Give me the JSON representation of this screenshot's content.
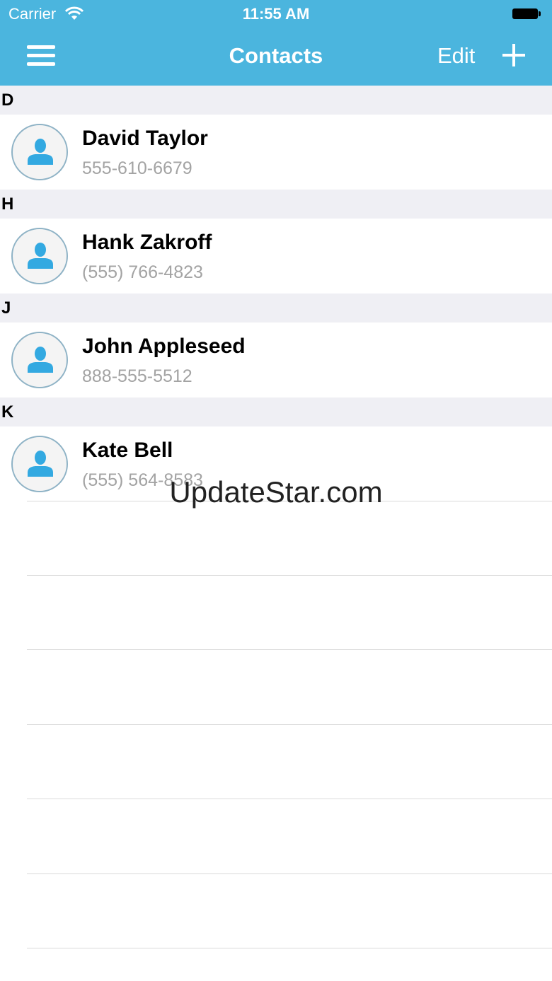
{
  "status_bar": {
    "carrier": "Carrier",
    "time": "11:55 AM"
  },
  "nav_bar": {
    "title": "Contacts",
    "edit_label": "Edit"
  },
  "sections": [
    {
      "letter": "D",
      "contacts": [
        {
          "name": "David Taylor",
          "phone": "555-610-6679"
        }
      ]
    },
    {
      "letter": "H",
      "contacts": [
        {
          "name": "Hank Zakroff",
          "phone": "(555) 766-4823"
        }
      ]
    },
    {
      "letter": "J",
      "contacts": [
        {
          "name": "John Appleseed",
          "phone": "888-555-5512"
        }
      ]
    },
    {
      "letter": "K",
      "contacts": [
        {
          "name": "Kate Bell",
          "phone": "(555) 564-8583"
        }
      ]
    }
  ],
  "watermark": "UpdateStar.com",
  "colors": {
    "header_bg": "#4bb5de",
    "section_bg": "#efeff4",
    "avatar_icon": "#33a9e1",
    "phone_text": "#a3a3a3"
  },
  "icons": {
    "menu": "hamburger-icon",
    "add": "plus-icon",
    "avatar": "person-silhouette-icon",
    "wifi": "wifi-icon",
    "battery": "battery-icon"
  }
}
